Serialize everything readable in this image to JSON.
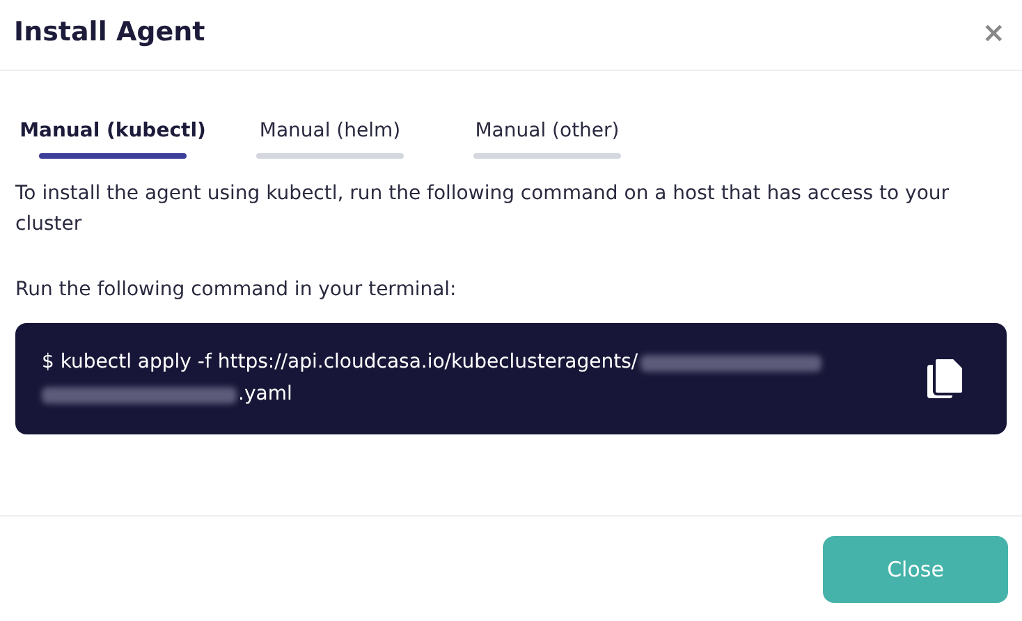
{
  "dialog": {
    "title": "Install Agent",
    "close_icon": "×"
  },
  "tabs": [
    {
      "label": "Manual (kubectl)",
      "selected": true
    },
    {
      "label": "Manual (helm)",
      "selected": false
    },
    {
      "label": "Manual (other)",
      "selected": false
    }
  ],
  "description": "To install the agent using kubectl, run the following command on a host that has access to your cluster",
  "instruction": "Run the following command in your terminal:",
  "command": {
    "prefix": "$ kubectl apply -f https://api.cloudcasa.io/kubeclusteragents/",
    "redacted": true,
    "suffix": ".yaml"
  },
  "buttons": [
    {
      "label": "Close"
    }
  ]
}
